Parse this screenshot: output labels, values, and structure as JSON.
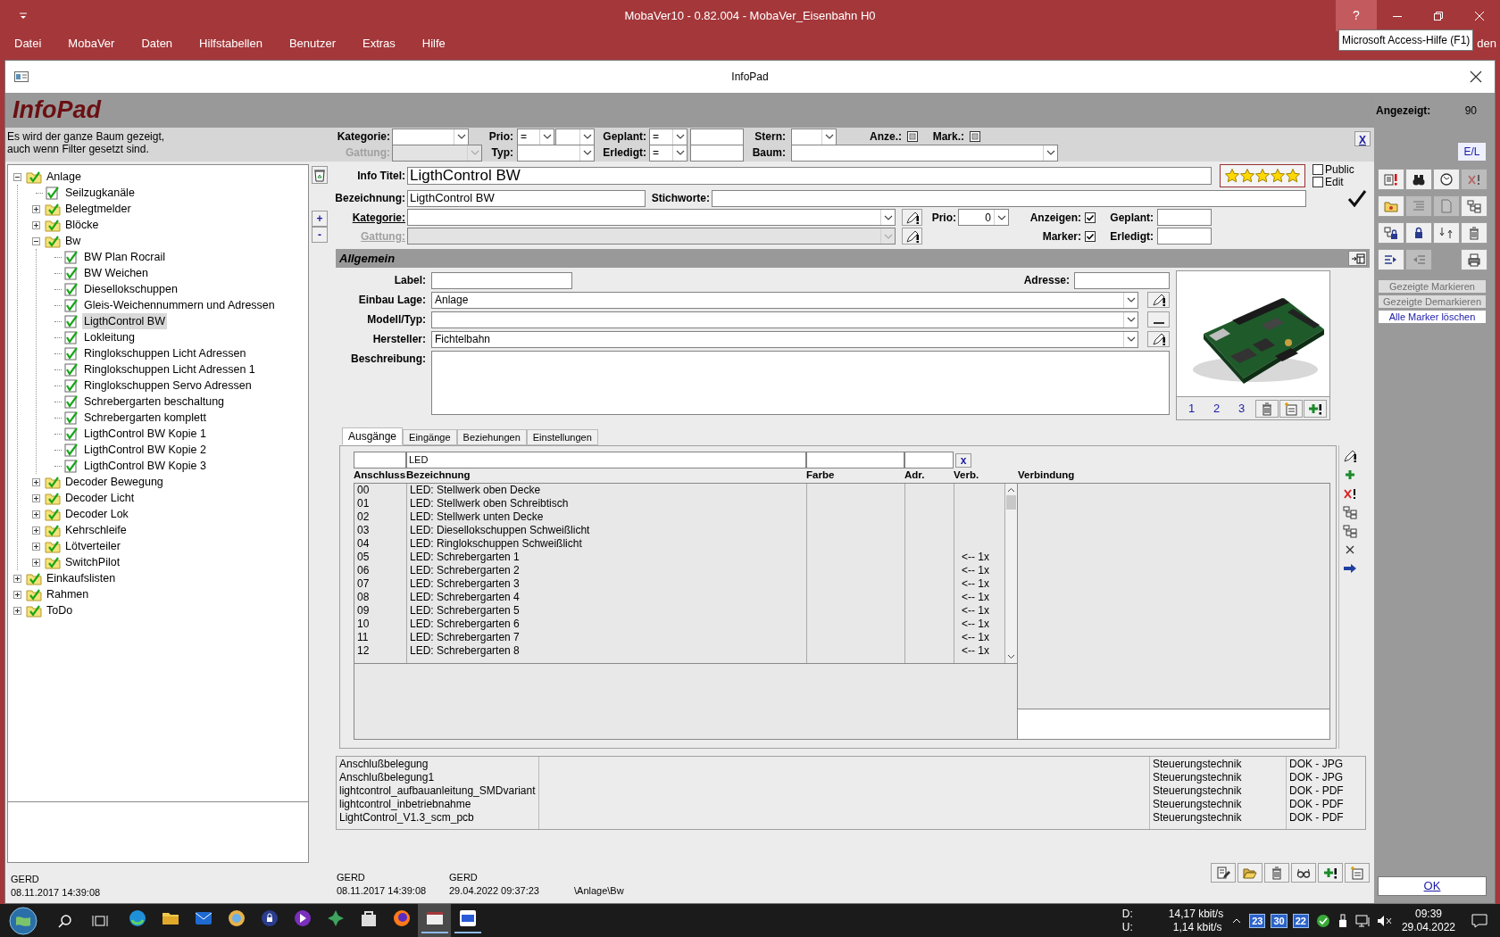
{
  "app": {
    "title": "MobaVer10 - 0.82.004 - MobaVer_Eisenbahn H0",
    "help_button": "?",
    "menu": [
      "Datei",
      "MobaVer",
      "Daten",
      "Hilfstabellen",
      "Benutzer",
      "Extras",
      "Hilfe"
    ],
    "menu_fragment": "den",
    "tooltip": "Microsoft Access-Hilfe (F1)"
  },
  "form": {
    "window_title": "InfoPad",
    "heading": "InfoPad",
    "shown_label": "Angezeigt:",
    "shown_count": "90"
  },
  "filter": {
    "note": "Es wird der ganze Baum gezeigt,\nauch wenn Filter gesetzt sind.",
    "kategorie": {
      "label": "Kategorie:"
    },
    "gattung": {
      "label": "Gattung:",
      "disabled": true
    },
    "prio": {
      "label": "Prio:",
      "operator": "="
    },
    "typ": {
      "label": "Typ:"
    },
    "geplant": {
      "label": "Geplant:",
      "operator": "="
    },
    "erledigt": {
      "label": "Erledigt:",
      "operator": "="
    },
    "stern": {
      "label": "Stern:"
    },
    "baum": {
      "label": "Baum:"
    },
    "anze": {
      "label": "Anze.:",
      "indeterminate": true
    },
    "mark": {
      "label": "Mark.:",
      "indeterminate": true
    },
    "clear_button": "X"
  },
  "tree": [
    {
      "label": "Anlage",
      "kind": "folder",
      "expanded": true,
      "selected": false,
      "children": [
        {
          "label": "Seilzugkanäle",
          "kind": "page",
          "selected": false
        },
        {
          "label": "Belegtmelder",
          "kind": "folder",
          "expanded": false,
          "selected": false
        },
        {
          "label": "Blöcke",
          "kind": "folder",
          "expanded": false,
          "selected": false
        },
        {
          "label": "Bw",
          "kind": "folder",
          "expanded": true,
          "selected": false,
          "children": [
            {
              "label": "BW Plan Rocrail",
              "kind": "page",
              "selected": false
            },
            {
              "label": "BW Weichen",
              "kind": "page",
              "selected": false
            },
            {
              "label": "Diesellokschuppen",
              "kind": "page",
              "selected": false
            },
            {
              "label": "Gleis-Weichennummern und Adressen",
              "kind": "page",
              "selected": false
            },
            {
              "label": "LigthControl BW",
              "kind": "page",
              "selected": true
            },
            {
              "label": "Lokleitung",
              "kind": "page",
              "selected": false
            },
            {
              "label": "Ringlokschuppen Licht Adressen",
              "kind": "page",
              "selected": false
            },
            {
              "label": "Ringlokschuppen Licht Adressen 1",
              "kind": "page",
              "selected": false
            },
            {
              "label": "Ringlokschuppen Servo Adressen",
              "kind": "page",
              "selected": false
            },
            {
              "label": "Schrebergarten beschaltung",
              "kind": "page",
              "selected": false
            },
            {
              "label": "Schrebergarten komplett",
              "kind": "page",
              "selected": false
            },
            {
              "label": "LigthControl BW Kopie 1",
              "kind": "page",
              "selected": false
            },
            {
              "label": "LigthControl BW Kopie 2",
              "kind": "page",
              "selected": false
            },
            {
              "label": "LigthControl BW Kopie 3",
              "kind": "page",
              "selected": false
            }
          ]
        },
        {
          "label": "Decoder Bewegung",
          "kind": "folder",
          "expanded": false,
          "selected": false
        },
        {
          "label": "Decoder Licht",
          "kind": "folder",
          "expanded": false,
          "selected": false
        },
        {
          "label": "Decoder Lok",
          "kind": "folder",
          "expanded": false,
          "selected": false
        },
        {
          "label": "Kehrschleife",
          "kind": "folder",
          "expanded": false,
          "selected": false
        },
        {
          "label": "Lötverteiler",
          "kind": "folder",
          "expanded": false,
          "selected": false
        },
        {
          "label": "SwitchPilot",
          "kind": "folder",
          "expanded": false,
          "selected": false
        }
      ]
    },
    {
      "label": "Einkaufslisten",
      "kind": "folder",
      "expanded": false,
      "selected": false
    },
    {
      "label": "Rahmen",
      "kind": "folder",
      "expanded": false,
      "selected": false
    },
    {
      "label": "ToDo",
      "kind": "folder",
      "expanded": false,
      "selected": false
    }
  ],
  "tree_buttons": {
    "expand": "+",
    "collapse": "-"
  },
  "tree_footer": {
    "user": "GERD",
    "date": "08.11.2017 14:39:08"
  },
  "record": {
    "info_title": {
      "label": "Info Titel:",
      "value": "LigthControl BW"
    },
    "stars": 5,
    "public": {
      "label": "Public",
      "checked": false
    },
    "edit": {
      "label": "Edit",
      "checked": false
    },
    "bezeichnung": {
      "label": "Bezeichnung:",
      "value": "LigthControl BW"
    },
    "stichworte": {
      "label": "Stichworte:"
    },
    "kategorie": {
      "label": "Kategorie:"
    },
    "gattung": {
      "label": "Gattung:",
      "disabled": true
    },
    "prio": {
      "label": "Prio:",
      "value": "0"
    },
    "anzeigen": {
      "label": "Anzeigen:",
      "checked": true
    },
    "marker": {
      "label": "Marker:",
      "checked": true
    },
    "geplant": {
      "label": "Geplant:"
    },
    "erledigt": {
      "label": "Erledigt:"
    }
  },
  "allgemein": {
    "title": "Allgemein",
    "label": {
      "label": "Label:"
    },
    "adresse": {
      "label": "Adresse:"
    },
    "einbau_lage": {
      "label": "Einbau Lage:",
      "value": "Anlage"
    },
    "modell_typ": {
      "label": "Modell/Typ:"
    },
    "hersteller": {
      "label": "Hersteller:",
      "value": "Fichtelbahn"
    },
    "beschreibung": {
      "label": "Beschreibung:"
    },
    "image": {
      "kind": "picture",
      "pages": [
        "1",
        "2",
        "3"
      ]
    }
  },
  "tabs": [
    {
      "label": "Ausgänge",
      "selected": true
    },
    {
      "label": "Eingänge",
      "selected": false
    },
    {
      "label": "Beziehungen",
      "selected": false
    },
    {
      "label": "Einstellungen",
      "selected": false
    }
  ],
  "outputs": {
    "filter_bezeichnung": "LED",
    "clear_button": "x",
    "columns": [
      "Anschluss",
      "Bezeichnung",
      "Farbe",
      "Adr.",
      "Verb."
    ],
    "connection_header": "Verbindung",
    "rows": [
      {
        "anschluss": "00",
        "bezeichnung": "LED: Stellwerk oben Decke"
      },
      {
        "anschluss": "01",
        "bezeichnung": "LED: Stellwerk oben Schreibtisch"
      },
      {
        "anschluss": "02",
        "bezeichnung": "LED: Stellwerk unten Decke"
      },
      {
        "anschluss": "03",
        "bezeichnung": "LED: Diesellokschuppen Schweißlicht"
      },
      {
        "anschluss": "04",
        "bezeichnung": "LED: Ringlokschuppen Schweißlicht"
      },
      {
        "anschluss": "05",
        "bezeichnung": "LED: Schrebergarten 1",
        "verb": "<-- 1x"
      },
      {
        "anschluss": "06",
        "bezeichnung": "LED: Schrebergarten 2",
        "verb": "<-- 1x"
      },
      {
        "anschluss": "07",
        "bezeichnung": "LED: Schrebergarten 3",
        "verb": "<-- 1x"
      },
      {
        "anschluss": "08",
        "bezeichnung": "LED: Schrebergarten 4",
        "verb": "<-- 1x"
      },
      {
        "anschluss": "09",
        "bezeichnung": "LED: Schrebergarten 5",
        "verb": "<-- 1x"
      },
      {
        "anschluss": "10",
        "bezeichnung": "LED: Schrebergarten 6",
        "verb": "<-- 1x"
      },
      {
        "anschluss": "11",
        "bezeichnung": "LED: Schrebergarten 7",
        "verb": "<-- 1x"
      },
      {
        "anschluss": "12",
        "bezeichnung": "LED: Schrebergarten 8",
        "verb": "<-- 1x"
      }
    ]
  },
  "documents": [
    {
      "name": "Anschlußbelegung",
      "category": "Steuerungstechnik",
      "type": "DOK - JPG"
    },
    {
      "name": "Anschlußbelegung1",
      "category": "Steuerungstechnik",
      "type": "DOK - JPG"
    },
    {
      "name": "lightcontrol_aufbauanleitung_SMDvariant",
      "category": "Steuerungstechnik",
      "type": "DOK - PDF"
    },
    {
      "name": "lightcontrol_inbetriebnahme",
      "category": "Steuerungstechnik",
      "type": "DOK - PDF"
    },
    {
      "name": "LightControl_V1.3_scm_pcb",
      "category": "Steuerungstechnik",
      "type": "DOK - PDF"
    }
  ],
  "footer": {
    "created": {
      "user": "GERD",
      "date": "08.11.2017 14:39:08"
    },
    "modified": {
      "user": "GERD",
      "date": "29.04.2022 09:37:23"
    },
    "path": "\\Anlage\\Bw"
  },
  "side_panel": {
    "el_button": "E/L",
    "icon_buttons": [
      {
        "disabled": false
      },
      {
        "disabled": false
      },
      {
        "disabled": false
      },
      {
        "disabled": true
      },
      {
        "disabled": false
      },
      {
        "disabled": true
      },
      {
        "disabled": true
      },
      {
        "disabled": false
      },
      {
        "disabled": false
      },
      {
        "disabled": false
      },
      {
        "disabled": false
      },
      {
        "disabled": false
      },
      {
        "disabled": false
      },
      {
        "disabled": true
      },
      {
        "disabled": false
      }
    ],
    "text_buttons": [
      {
        "label": "Gezeigte Markieren",
        "disabled": true
      },
      {
        "label": "Gezeigte Demarkieren",
        "disabled": true
      },
      {
        "label": "Alle Marker löschen",
        "disabled": false
      }
    ],
    "ok_button": "OK"
  },
  "taskbar": {
    "apps": [
      {
        "active": false,
        "running": false
      },
      {
        "active": false,
        "running": false
      },
      {
        "active": false,
        "running": false
      },
      {
        "active": false,
        "running": false
      },
      {
        "active": false,
        "running": false
      },
      {
        "active": false,
        "running": false
      },
      {
        "active": false,
        "running": false
      },
      {
        "active": false,
        "running": false
      },
      {
        "active": false,
        "running": false
      },
      {
        "active": true,
        "running": true
      },
      {
        "active": false,
        "running": true
      }
    ],
    "net_down_label": "D:",
    "net_down": "14,17 kbit/s",
    "net_up_label": "U:",
    "net_up": "1,14 kbit/s",
    "tray_badges": [
      "23",
      "30",
      "22"
    ],
    "time": "09:39",
    "date": "29.04.2022"
  }
}
